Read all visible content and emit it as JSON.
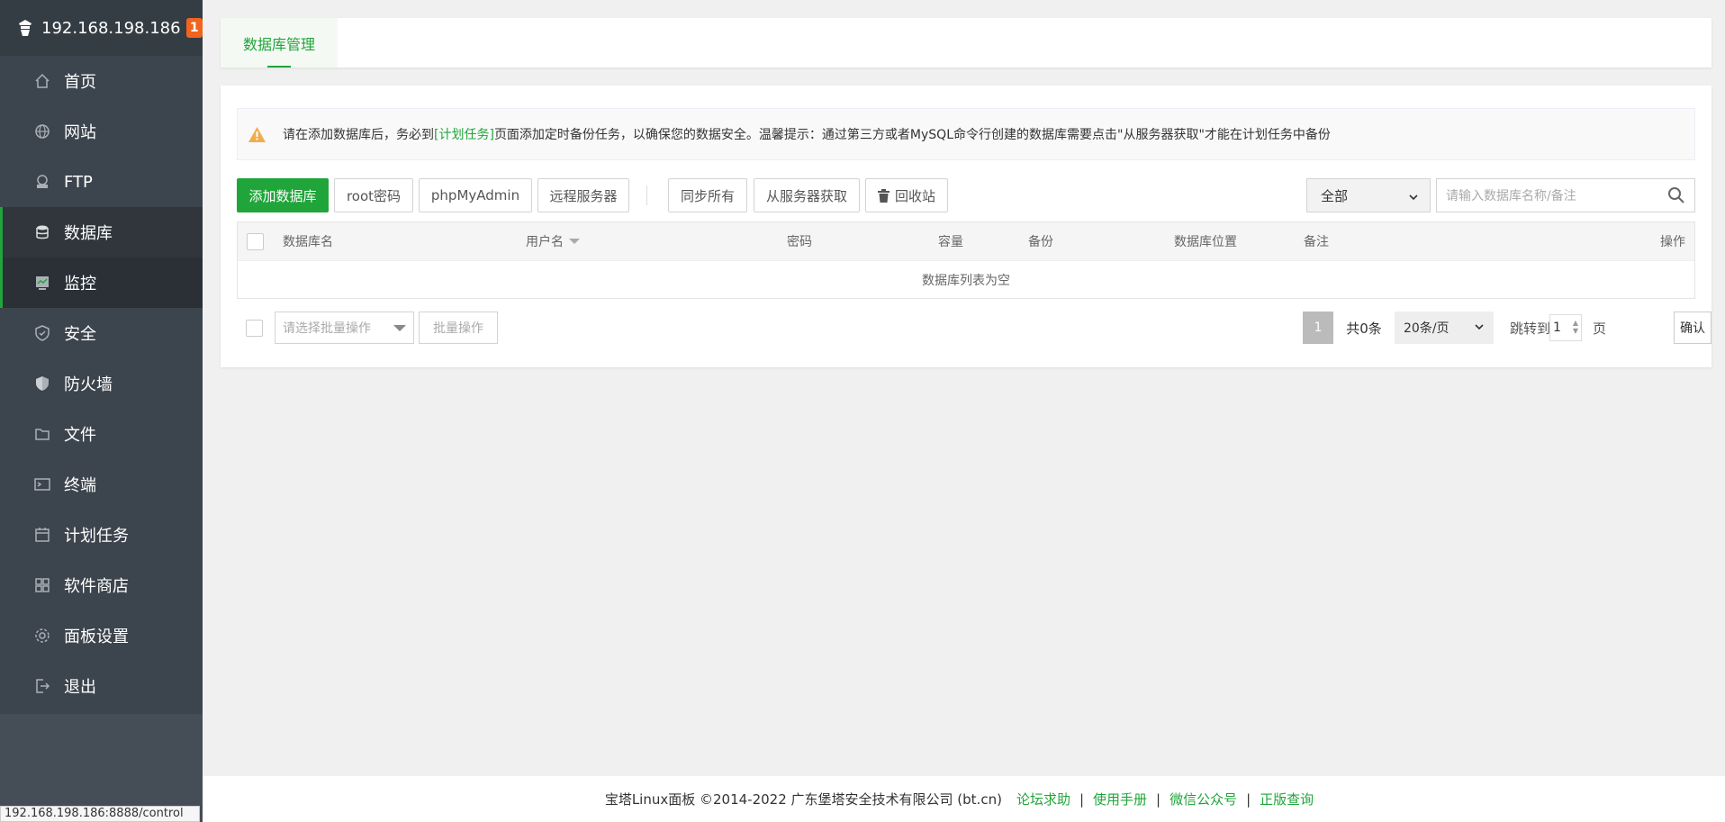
{
  "header": {
    "ip": "192.168.198.186",
    "badge": "1"
  },
  "sidebar": {
    "items": [
      {
        "label": "首页",
        "icon": "home-icon"
      },
      {
        "label": "网站",
        "icon": "globe-icon"
      },
      {
        "label": "FTP",
        "icon": "ftp-icon"
      },
      {
        "label": "数据库",
        "icon": "database-icon"
      },
      {
        "label": "监控",
        "icon": "monitor-icon"
      },
      {
        "label": "安全",
        "icon": "shield-check-icon"
      },
      {
        "label": "防火墙",
        "icon": "firewall-shield-icon"
      },
      {
        "label": "文件",
        "icon": "folder-icon"
      },
      {
        "label": "终端",
        "icon": "terminal-icon"
      },
      {
        "label": "计划任务",
        "icon": "calendar-icon"
      },
      {
        "label": "软件商店",
        "icon": "apps-grid-icon"
      },
      {
        "label": "面板设置",
        "icon": "gear-icon"
      },
      {
        "label": "退出",
        "icon": "logout-icon"
      }
    ]
  },
  "status_url": "192.168.198.186:8888/control",
  "tabs": {
    "active": "数据库管理"
  },
  "alert": {
    "prefix": "请在添加数据库后，务必到",
    "link": "[计划任务]",
    "suffix": "页面添加定时备份任务，以确保您的数据安全。温馨提示：通过第三方或者MySQL命令行创建的数据库需要点击\"从服务器获取\"才能在计划任务中备份"
  },
  "toolbar": {
    "add": "添加数据库",
    "root_pwd": "root密码",
    "phpmyadmin": "phpMyAdmin",
    "remote": "远程服务器",
    "sync_all": "同步所有",
    "fetch": "从服务器获取",
    "recycle": "回收站",
    "filter_value": "全部",
    "search_placeholder": "请输入数据库名称/备注"
  },
  "table": {
    "columns": [
      "数据库名",
      "用户名",
      "密码",
      "容量",
      "备份",
      "数据库位置",
      "备注",
      "操作"
    ],
    "empty_text": "数据库列表为空"
  },
  "batch": {
    "placeholder": "请选择批量操作",
    "button": "批量操作"
  },
  "pager": {
    "current": "1",
    "total": "共0条",
    "size": "20条/页",
    "jump_label": "跳转到",
    "jump_value": "1",
    "page_label": "页",
    "confirm": "确认"
  },
  "footer": {
    "copyright": "宝塔Linux面板 ©2014-2022 广东堡塔安全技术有限公司 (bt.cn)",
    "links": [
      "论坛求助",
      "使用手册",
      "微信公众号",
      "正版查询"
    ],
    "separator": "|"
  },
  "colors": {
    "accent": "#20a53a",
    "sidebar_bg": "#3c444d",
    "badge": "#f0641e"
  }
}
